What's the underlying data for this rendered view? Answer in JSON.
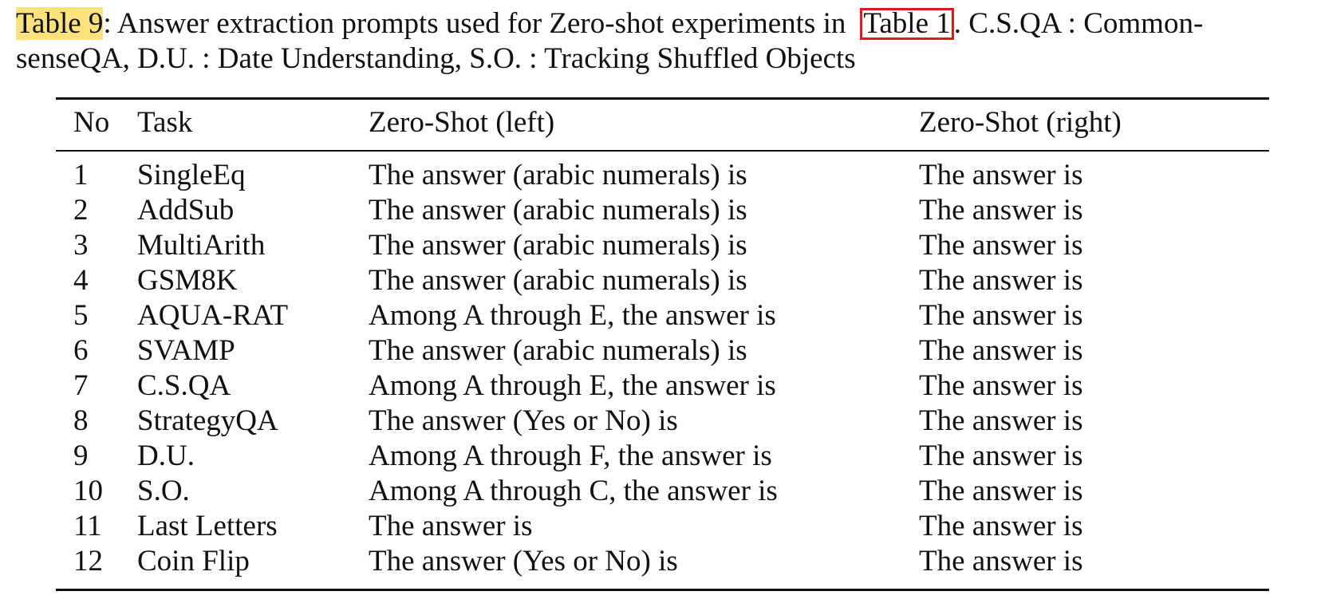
{
  "caption": {
    "label": "Table 9",
    "text_before_ref": ": Answer extraction prompts used for Zero-shot experiments in",
    "ref": "Table 1",
    "text_after_ref": ". C.S.QA : Common-",
    "line2": "senseQA, D.U. : Date Understanding, S.O. : Tracking Shuffled Objects",
    "highlight_color": "#fbe27d",
    "ref_box_color": "#e0191e"
  },
  "table": {
    "headers": {
      "no": "No",
      "task": "Task",
      "left": "Zero-Shot (left)",
      "right": "Zero-Shot (right)"
    },
    "rows": [
      {
        "no": "1",
        "task": "SingleEq",
        "left": "The answer (arabic numerals) is",
        "right": "The answer is"
      },
      {
        "no": "2",
        "task": "AddSub",
        "left": "The answer (arabic numerals) is",
        "right": "The answer is"
      },
      {
        "no": "3",
        "task": "MultiArith",
        "left": "The answer (arabic numerals) is",
        "right": "The answer is"
      },
      {
        "no": "4",
        "task": "GSM8K",
        "left": "The answer (arabic numerals) is",
        "right": "The answer is"
      },
      {
        "no": "5",
        "task": "AQUA-RAT",
        "left": "Among A through E, the answer is",
        "right": "The answer is"
      },
      {
        "no": "6",
        "task": "SVAMP",
        "left": "The answer (arabic numerals) is",
        "right": "The answer is"
      },
      {
        "no": "7",
        "task": "C.S.QA",
        "left": "Among A through E, the answer is",
        "right": "The answer is"
      },
      {
        "no": "8",
        "task": "StrategyQA",
        "left": "The answer (Yes or No) is",
        "right": "The answer is"
      },
      {
        "no": "9",
        "task": "D.U.",
        "left": "Among A through F, the answer is",
        "right": "The answer is"
      },
      {
        "no": "10",
        "task": "S.O.",
        "left": "Among A through C, the answer is",
        "right": "The answer is"
      },
      {
        "no": "11",
        "task": "Last Letters",
        "left": "The answer is",
        "right": "The answer is"
      },
      {
        "no": "12",
        "task": "Coin Flip",
        "left": "The answer (Yes or No) is",
        "right": "The answer is"
      }
    ]
  }
}
